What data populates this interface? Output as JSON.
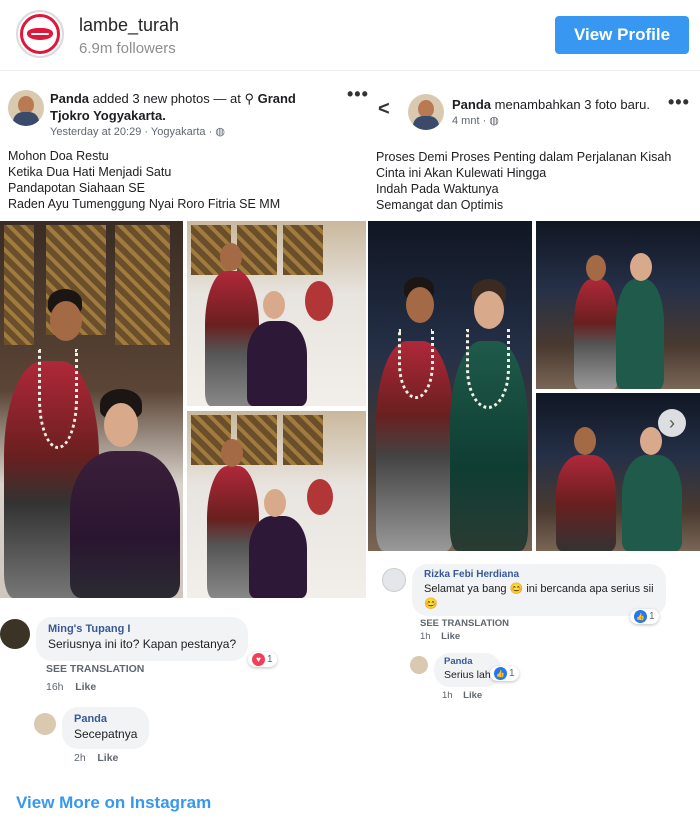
{
  "instagram": {
    "username": "lambe_turah",
    "followers": "6.9m followers",
    "view_profile_label": "View Profile",
    "view_more_label": "View More on Instagram",
    "accent_color": "#3897f0"
  },
  "left_post": {
    "author": "Panda",
    "action": "added 3 new photos — at",
    "location": "Grand Tjokro Yogyakarta.",
    "location_icon": "location-pin-icon",
    "time": "Yesterday at 20:29 · Yogyakarta ·",
    "privacy_icon": "globe-icon",
    "more_label": "•••",
    "lines": [
      "Mohon Doa Restu",
      "Ketika Dua Hati Menjadi Satu",
      "Pandapotan Siahaan SE",
      "Raden Ayu Tumenggung Nyai Roro Fitria SE MM"
    ],
    "comments": [
      {
        "name": "Ming's Tupang I",
        "text": "Seriusnya ini ito?  Kapan pestanya?",
        "see_translation": "SEE TRANSLATION",
        "time": "16h",
        "like": "Like",
        "reaction_count": "1"
      },
      {
        "name": "Panda",
        "text": "Secepatnya",
        "time": "2h",
        "like": "Like"
      }
    ]
  },
  "right_post": {
    "back_label": "<",
    "author": "Panda",
    "action": "menambahkan 3 foto baru.",
    "time": "4 mnt ·",
    "more_label": "•••",
    "lines": [
      "Proses Demi Proses Penting dalam Perjalanan Kisah",
      "Cinta ini Akan Kulewati Hingga",
      "Indah Pada Waktunya",
      "Semangat dan Optimis"
    ],
    "next_label": "›",
    "comments": [
      {
        "name": "Rizka Febi Herdiana",
        "text": "Selamat ya bang 😊 ini bercanda apa serius sii",
        "text2": "😊",
        "see_translation": "SEE TRANSLATION",
        "time": "1h",
        "like": "Like",
        "reaction_count": "1"
      },
      {
        "name": "Panda",
        "text": "Serius lah",
        "time": "1h",
        "like": "Like",
        "reaction_count": "1"
      }
    ]
  }
}
